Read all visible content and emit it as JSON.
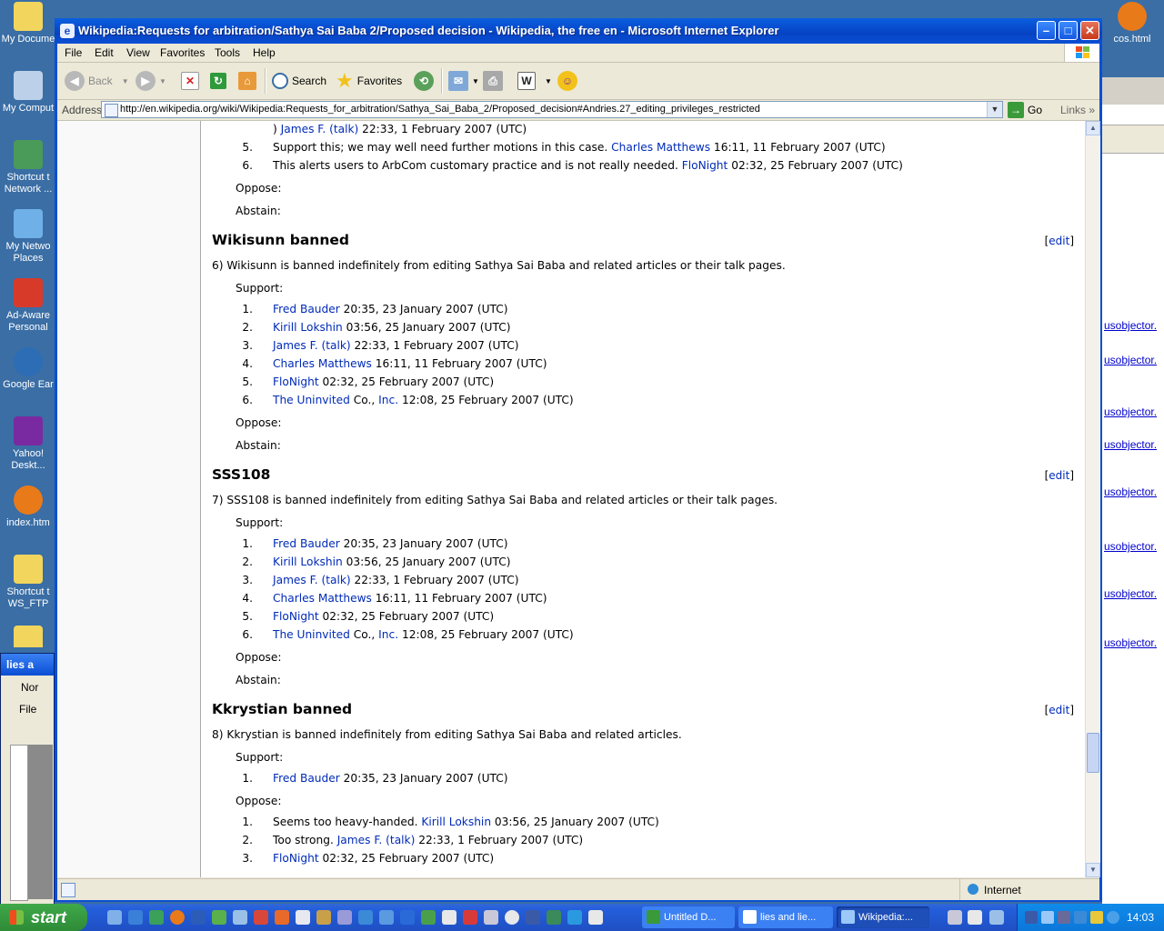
{
  "desktop": {
    "icons": [
      {
        "label": "My Docume"
      },
      {
        "label": "My Comput"
      },
      {
        "label": "Shortcut t Network ..."
      },
      {
        "label": "My Netwo Places"
      },
      {
        "label": "Ad-Aware Personal"
      },
      {
        "label": "Google Ear"
      },
      {
        "label": "Yahoo! Deskt..."
      },
      {
        "label": "index.htm"
      },
      {
        "label": "Shortcut t WS_FTP"
      }
    ],
    "right_icon_label": "cos.html",
    "behind_links": [
      "usobjector.",
      "usobjector.",
      "usobjector.",
      "usobjector.",
      "usobjector.",
      "usobjector.",
      "usobjector.",
      "usobjector."
    ],
    "word_fragment": {
      "title": "lies a",
      "style": "Nor",
      "menu": "File"
    }
  },
  "window": {
    "title": "Wikipedia:Requests for arbitration/Sathya Sai Baba 2/Proposed decision - Wikipedia, the free en - Microsoft Internet Explorer",
    "menu": [
      "File",
      "Edit",
      "View",
      "Favorites",
      "Tools",
      "Help"
    ],
    "toolbar": {
      "back": "Back",
      "search": "Search",
      "favorites": "Favorites"
    },
    "address_label": "Address",
    "url": "http://en.wikipedia.org/wiki/Wikipedia:Requests_for_arbitration/Sathya_Sai_Baba_2/Proposed_decision#Andries.27_editing_privileges_restricted",
    "go_label": "Go",
    "links_label": "Links",
    "status_zone": "Internet"
  },
  "article": {
    "top_items": [
      {
        "n": "",
        "link": "James F. (talk)",
        "pre": ") ",
        "post": " 22:33, 1 February 2007 (UTC)"
      },
      {
        "n": "5.",
        "pre": "Support this; we may well need further motions in this case. ",
        "link": "Charles Matthews",
        "post": " 16:11, 11 February 2007 (UTC)"
      },
      {
        "n": "6.",
        "pre": "This alerts users to ArbCom customary practice and is not really needed. ",
        "link": "FloNight",
        "post": " 02:32, 25 February 2007 (UTC)"
      }
    ],
    "oppose_label": "Oppose:",
    "abstain_label": "Abstain:",
    "support_label": "Support:",
    "edit_label": "edit",
    "sections": [
      {
        "heading": "Wikisunn banned",
        "text": "6) Wikisunn is banned indefinitely from editing Sathya Sai Baba and related articles or their talk pages.",
        "support": [
          {
            "n": "1.",
            "link": "Fred Bauder",
            "post": " 20:35, 23 January 2007 (UTC)"
          },
          {
            "n": "2.",
            "link": "Kirill Lokshin",
            "post": " 03:56, 25 January 2007 (UTC)"
          },
          {
            "n": "3.",
            "link": "James F. (talk)",
            "post": " 22:33, 1 February 2007 (UTC)"
          },
          {
            "n": "4.",
            "link": "Charles Matthews",
            "post": " 16:11, 11 February 2007 (UTC)"
          },
          {
            "n": "5.",
            "link": "FloNight",
            "post": " 02:32, 25 February 2007 (UTC)"
          },
          {
            "n": "6.",
            "link": "The Uninvited",
            "mid": " Co., ",
            "link2": "Inc.",
            "post": " 12:08, 25 February 2007 (UTC)"
          }
        ]
      },
      {
        "heading": "SSS108",
        "text": "7) SSS108 is banned indefinitely from editing Sathya Sai Baba and related articles or their talk pages.",
        "support": [
          {
            "n": "1.",
            "link": "Fred Bauder",
            "post": " 20:35, 23 January 2007 (UTC)"
          },
          {
            "n": "2.",
            "link": "Kirill Lokshin",
            "post": " 03:56, 25 January 2007 (UTC)"
          },
          {
            "n": "3.",
            "link": "James F. (talk)",
            "post": " 22:33, 1 February 2007 (UTC)"
          },
          {
            "n": "4.",
            "link": "Charles Matthews",
            "post": " 16:11, 11 February 2007 (UTC)"
          },
          {
            "n": "5.",
            "link": "FloNight",
            "post": " 02:32, 25 February 2007 (UTC)"
          },
          {
            "n": "6.",
            "link": "The Uninvited",
            "mid": " Co., ",
            "link2": "Inc.",
            "post": " 12:08, 25 February 2007 (UTC)"
          }
        ]
      },
      {
        "heading": "Kkrystian banned",
        "text": "8) Kkrystian is banned indefinitely from editing Sathya Sai Baba and related articles.",
        "support": [
          {
            "n": "1.",
            "link": "Fred Bauder",
            "post": " 20:35, 23 January 2007 (UTC)"
          }
        ],
        "oppose": [
          {
            "n": "1.",
            "pre": "Seems too heavy-handed. ",
            "link": "Kirill Lokshin",
            "post": " 03:56, 25 January 2007 (UTC)"
          },
          {
            "n": "2.",
            "pre": "Too strong. ",
            "link": "James F. (talk)",
            "post": " 22:33, 1 February 2007 (UTC)"
          },
          {
            "n": "3.",
            "link": "FloNight",
            "post": " 02:32, 25 February 2007 (UTC)"
          }
        ]
      }
    ]
  },
  "taskbar": {
    "start": "start",
    "tasks": [
      "Untitled D...",
      "lies and lie...",
      "Wikipedia:..."
    ],
    "clock": "14:03"
  }
}
